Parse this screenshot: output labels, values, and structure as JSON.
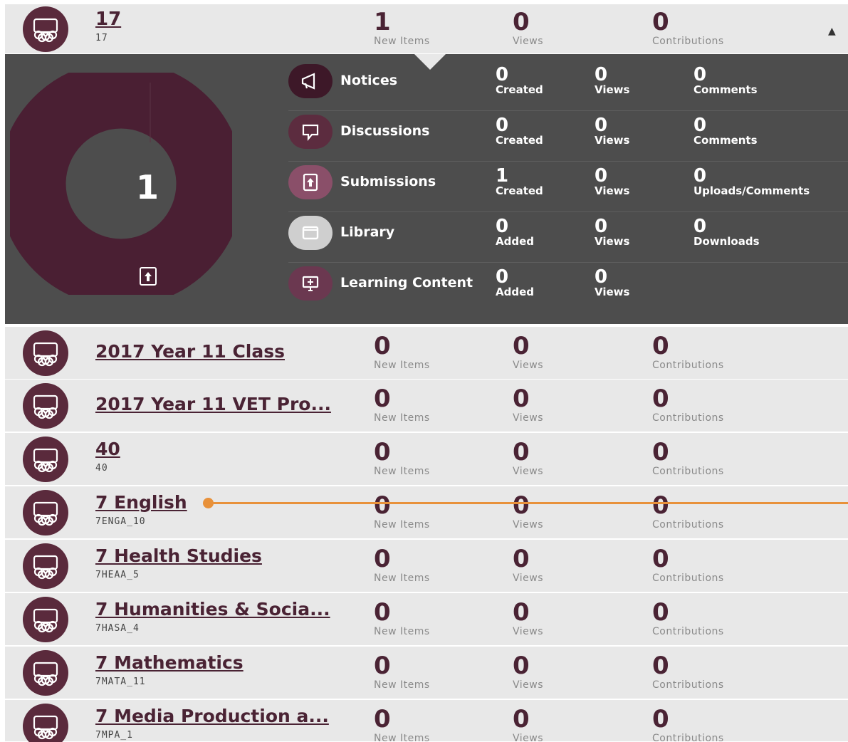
{
  "top_group": {
    "title": "17",
    "code": "17",
    "stats": [
      {
        "value": "1",
        "label": "New Items"
      },
      {
        "value": "0",
        "label": "Views"
      },
      {
        "value": "0",
        "label": "Contributions"
      }
    ],
    "collapse_icon": "caret-up-icon"
  },
  "panel": {
    "donut_total": "1",
    "donut_color": "#4a1f33",
    "donut_icon": "submission-icon",
    "activities": [
      {
        "name": "Notices",
        "icon": "megaphone-icon",
        "icon_bg": "#3d1828",
        "stats": [
          {
            "value": "0",
            "label": "Created"
          },
          {
            "value": "0",
            "label": "Views"
          },
          {
            "value": "0",
            "label": "Comments"
          }
        ]
      },
      {
        "name": "Discussions",
        "icon": "chat-icon",
        "icon_bg": "#5c2c3f",
        "stats": [
          {
            "value": "0",
            "label": "Created"
          },
          {
            "value": "0",
            "label": "Views"
          },
          {
            "value": "0",
            "label": "Comments"
          }
        ]
      },
      {
        "name": "Submissions",
        "icon": "upload-icon",
        "icon_bg": "#8a4f69",
        "stats": [
          {
            "value": "1",
            "label": "Created"
          },
          {
            "value": "0",
            "label": "Views"
          },
          {
            "value": "0",
            "label": "Uploads/Comments"
          }
        ]
      },
      {
        "name": "Library",
        "icon": "folder-icon",
        "icon_bg": "#cfcfcf",
        "stats": [
          {
            "value": "0",
            "label": "Added"
          },
          {
            "value": "0",
            "label": "Views"
          },
          {
            "value": "0",
            "label": "Downloads"
          }
        ]
      },
      {
        "name": "Learning Content",
        "icon": "monitor-icon",
        "icon_bg": "#6b3850",
        "stats": [
          {
            "value": "0",
            "label": "Added"
          },
          {
            "value": "0",
            "label": "Views"
          }
        ]
      }
    ]
  },
  "groups": [
    {
      "title": "2017 Year 11 Class",
      "code": "",
      "new_items": "0",
      "views": "0",
      "contributions": "0"
    },
    {
      "title": "2017 Year 11 VET Pro...",
      "code": "",
      "new_items": "0",
      "views": "0",
      "contributions": "0"
    },
    {
      "title": "40",
      "code": "40",
      "new_items": "0",
      "views": "0",
      "contributions": "0"
    },
    {
      "title": "7 English",
      "code": "7ENGA_10",
      "new_items": "0",
      "views": "0",
      "contributions": "0"
    },
    {
      "title": "7 Health Studies",
      "code": "7HEAA_5",
      "new_items": "0",
      "views": "0",
      "contributions": "0"
    },
    {
      "title": "7 Humanities & Socia...",
      "code": "7HASA_4",
      "new_items": "0",
      "views": "0",
      "contributions": "0"
    },
    {
      "title": "7 Mathematics",
      "code": "7MATA_11",
      "new_items": "0",
      "views": "0",
      "contributions": "0"
    },
    {
      "title": "7 Media Production a...",
      "code": "7MPA_1",
      "new_items": "0",
      "views": "0",
      "contributions": "0"
    }
  ],
  "labels": {
    "new_items": "New Items",
    "views": "Views",
    "contributions": "Contributions"
  },
  "colors": {
    "brand": "#5a2a3c",
    "accent_line": "#e8913a",
    "row_bg": "#e8e8e8",
    "panel_bg": "#4d4d4d"
  }
}
